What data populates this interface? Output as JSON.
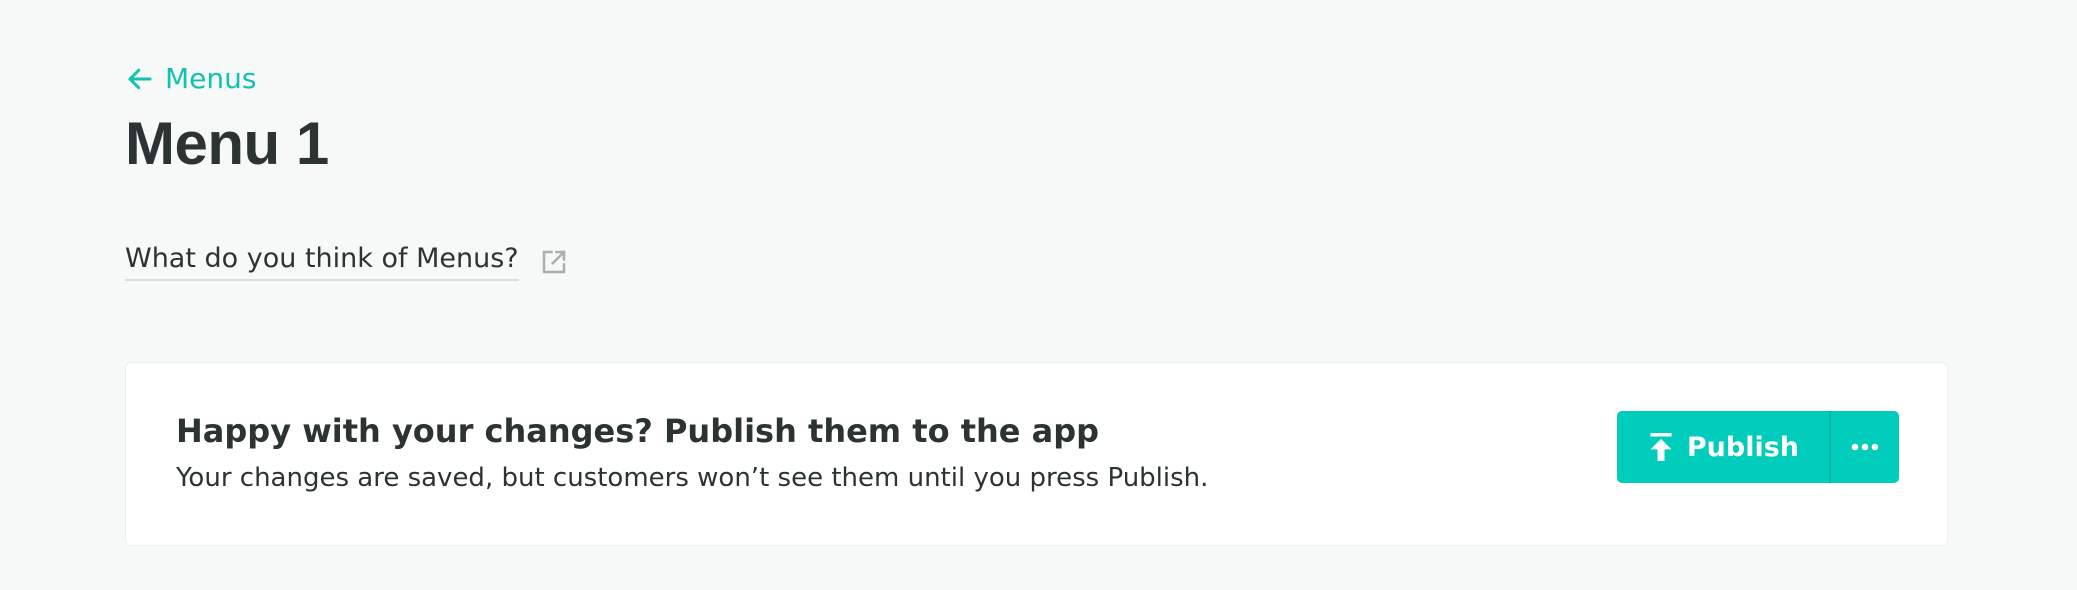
{
  "header": {
    "back_label": "Menus",
    "title": "Menu 1"
  },
  "feedback": {
    "link_text": "What do you think of Menus?"
  },
  "publish_card": {
    "heading": "Happy with your changes? Publish them to the app",
    "subtext": "Your changes are saved, but customers won’t see them until you press Publish.",
    "publish_label": "Publish"
  },
  "icons": {
    "back": "arrow-left-icon",
    "external": "external-link-icon",
    "publish": "upload-icon",
    "more": "more-horizontal-icon"
  },
  "colors": {
    "accent": "#00ccbb",
    "link": "#12c2b0",
    "text": "#2c3333",
    "background": "#f7f9f9",
    "card": "#ffffff"
  }
}
